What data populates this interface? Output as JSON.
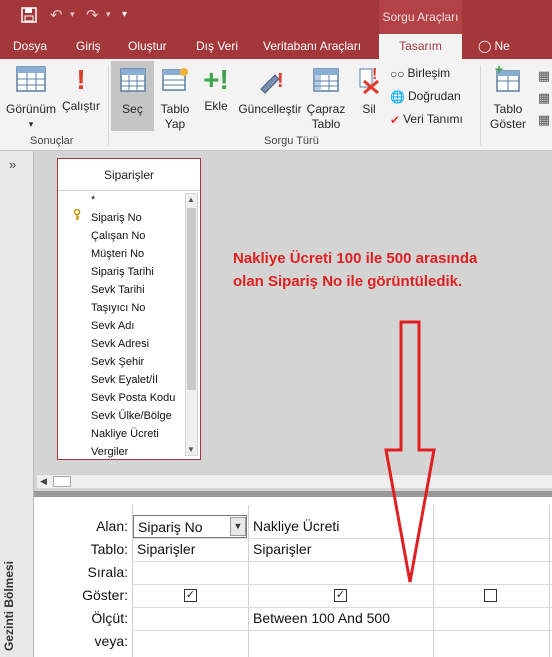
{
  "titlebar": {
    "save_icon": "save-icon",
    "undo_icon": "undo-icon",
    "redo_icon": "redo-icon",
    "customize_icon": "customize-quick-access-icon",
    "contextual_title": "Sorgu Araçları"
  },
  "tabs": [
    {
      "label": "Dosya"
    },
    {
      "label": "Giriş"
    },
    {
      "label": "Oluştur"
    },
    {
      "label": "Dış Veri"
    },
    {
      "label": "Veritabanı Araçları"
    },
    {
      "label": "Tasarım"
    },
    {
      "label": "Ne yapmak"
    }
  ],
  "ribbon": {
    "view_label": "Görünüm",
    "run_label": "Çalıştır",
    "select_label": "Seç",
    "maketable_label": "Tablo\nYap",
    "append_label": "Ekle",
    "update_label": "Güncelleştir",
    "crosstab_label": "Çapraz\nTablo",
    "delete_label": "Sil",
    "union_label": "Birleşim",
    "passthrough_label": "Doğrudan",
    "datadef_label": "Veri Tanımı",
    "showtable_label": "Tablo\nGöster",
    "group_results": "Sonuçlar",
    "group_querytype": "Sorgu Türü"
  },
  "nav": {
    "toggle": "»",
    "label": "Gezinti Bölmesi"
  },
  "table": {
    "title": "Siparişler",
    "fields": [
      "*",
      "Sipariş No",
      "Çalışan No",
      "Müşteri No",
      "Sipariş Tarihi",
      "Sevk Tarihi",
      "Taşıyıcı No",
      "Sevk Adı",
      "Sevk Adresi",
      "Sevk Şehir",
      "Sevk Eyalet/İl",
      "Sevk Posta Kodu",
      "Sevk Ülke/Bölge",
      "Nakliye Ücreti",
      "Vergiler"
    ]
  },
  "annotation": {
    "line1": "Nakliye Ücreti 100 ile 500 arasında",
    "line2": "olan Sipariş No ile görüntüledik."
  },
  "grid": {
    "labels": {
      "field": "Alan:",
      "table": "Tablo:",
      "sort": "Sırala:",
      "show": "Göster:",
      "criteria": "Ölçüt:",
      "or": "veya:"
    },
    "columns": [
      {
        "field": "Sipariş No",
        "table": "Siparişler",
        "sort": "",
        "show": true,
        "criteria": "",
        "or": ""
      },
      {
        "field": "Nakliye Ücreti",
        "table": "Siparişler",
        "sort": "",
        "show": true,
        "criteria": "Between 100 And 500",
        "or": ""
      },
      {
        "field": "",
        "table": "",
        "sort": "",
        "show": false,
        "criteria": "",
        "or": ""
      }
    ]
  },
  "colors": {
    "accent": "#a4373a",
    "annotation": "#e02020"
  }
}
